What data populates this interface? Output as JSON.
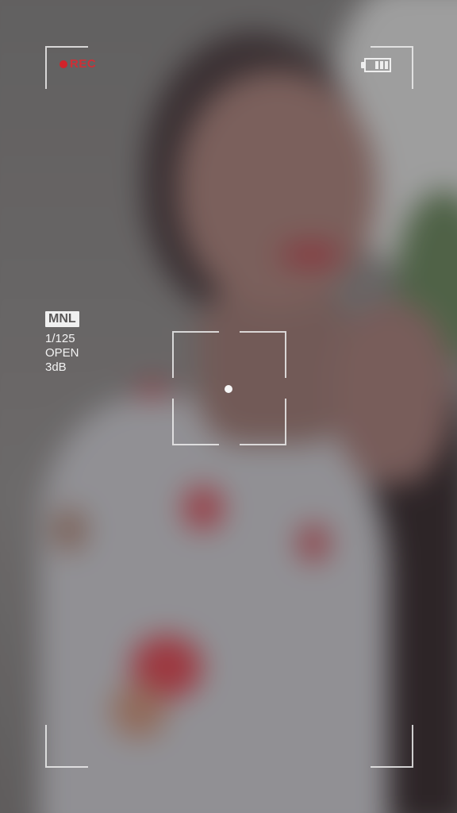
{
  "recording": {
    "label": "REC",
    "dot_color": "#d1232a"
  },
  "battery": {
    "icon": "battery-icon",
    "level_bars": 3,
    "max_bars": 3
  },
  "camera_settings": {
    "mode": "MNL",
    "shutter_speed": "1/125",
    "aperture": "OPEN",
    "gain": "3dB"
  },
  "focus": {
    "icon": "focus-frame-icon"
  },
  "colors": {
    "overlay": "#ececec",
    "rec_text": "#cf2f36"
  }
}
